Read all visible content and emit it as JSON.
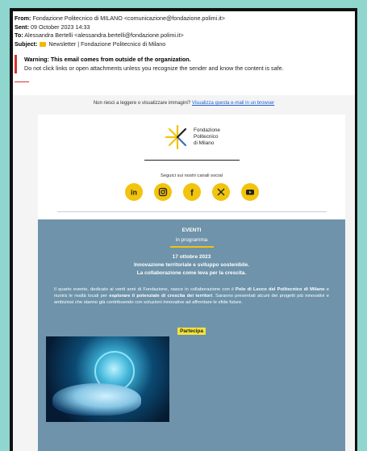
{
  "header": {
    "from_label": "From:",
    "from_value": "Fondazione Politecnico di MILANO <comunicazione@fondazione.polimi.it>",
    "sent_label": "Sent:",
    "sent_value": "09 October 2023 14:33",
    "to_label": "To:",
    "to_value": "Alessandra Bertelli <alessandra.bertelli@fondazione.polimi.it>",
    "subject_label": "Subject:",
    "subject_value": "Newsletter | Fondazione Politecnico di Milano"
  },
  "warning": {
    "title": "Warning: This email comes from outside of the organization.",
    "body": "Do not click links or open attachments unless you recognize the sender and know the content is safe."
  },
  "view_bar": {
    "text": "Non riesci a leggere o visualizzare immagini?",
    "link": "Visualizza questa e-mail in un browser"
  },
  "logo": {
    "line1": "Fondazione",
    "line2": "Politecnico",
    "line3": "di Milano"
  },
  "social": {
    "label": "Seguici sui nostri canali social",
    "icons": [
      "linkedin-icon",
      "instagram-icon",
      "facebook-icon",
      "x-icon",
      "youtube-icon"
    ]
  },
  "event": {
    "section_title": "EVENTI",
    "section_sub": "in programma",
    "date": "17 ottobre 2023",
    "headline1": "Innovazione territoriale e sviluppo sostenibile.",
    "headline2": "La collaborazione come leva per la crescita.",
    "desc_1": "Il quarto evento, dedicato ai venti anni di Fondazione, nasce in collaborazione con il ",
    "desc_2": "Polo di Lecco del Politecnico di Milano",
    "desc_3": " e riunirà le realtà locali per ",
    "desc_4": "esplorare il potenziale di crescita dei territori",
    "desc_5": ". Saranno presentati alcuni dei progetti più innovativi e ambiziosi che stanno già contribuendo con soluzioni innovative ad affrontare le sfide future.",
    "cta": "Partecipa"
  },
  "colors": {
    "accent": "#f2c40e",
    "panel": "#6e93aa",
    "warning": "#d6332b",
    "link": "#1a5fd6"
  }
}
